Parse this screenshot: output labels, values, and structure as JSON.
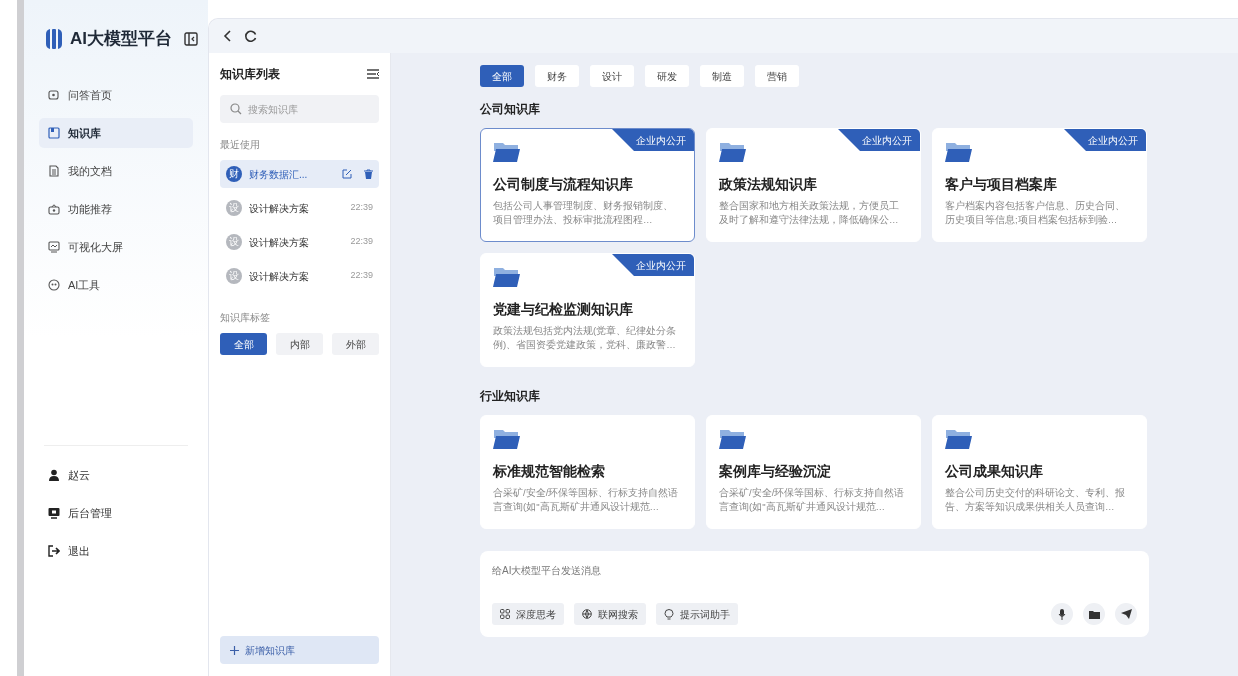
{
  "brand": "AI大模型平台",
  "sidebar": {
    "nav": [
      {
        "label": "问答首页",
        "selected": false
      },
      {
        "label": "知识库",
        "selected": true
      },
      {
        "label": "我的文档",
        "selected": false
      },
      {
        "label": "功能推荐",
        "selected": false
      },
      {
        "label": "可视化大屏",
        "selected": false
      },
      {
        "label": "AI工具",
        "selected": false
      }
    ],
    "user_menu": [
      {
        "label": "赵云"
      },
      {
        "label": "后台管理"
      },
      {
        "label": "退出"
      }
    ]
  },
  "list_panel": {
    "title": "知识库列表",
    "search": {
      "placeholder": "搜索知识库"
    },
    "recent_label": "最近使用",
    "recent": [
      {
        "avatar": "财",
        "name": "财务数据汇...",
        "selected": true
      },
      {
        "avatar": "设",
        "name": "设计解决方案",
        "time": "22:39",
        "selected": false
      },
      {
        "avatar": "设",
        "name": "设计解决方案",
        "time": "22:39",
        "selected": false
      },
      {
        "avatar": "设",
        "name": "设计解决方案",
        "time": "22:39",
        "selected": false
      }
    ],
    "tags_label": "知识库标签",
    "tags": [
      {
        "label": "全部",
        "selected": true
      },
      {
        "label": "内部",
        "selected": false
      },
      {
        "label": "外部",
        "selected": false
      }
    ],
    "add_button": "新增知识库"
  },
  "filters": [
    {
      "label": "全部",
      "selected": true
    },
    {
      "label": "财务",
      "selected": false
    },
    {
      "label": "设计",
      "selected": false
    },
    {
      "label": "研发",
      "selected": false
    },
    {
      "label": "制造",
      "selected": false
    },
    {
      "label": "营销",
      "selected": false
    }
  ],
  "sections": [
    {
      "title": "公司知识库",
      "cards": [
        {
          "title": "公司制度与流程知识库",
          "description": "包括公司人事管理制度、财务报销制度、项目管理办法、投标审批流程图程…",
          "badge": "企业内公开",
          "selected": true
        },
        {
          "title": "政策法规知识库",
          "description": "整合国家和地方相关政策法规，方便员工及时了解和遵守法律法规，降低确保公…",
          "badge": "企业内公开",
          "selected": false
        },
        {
          "title": "客户与项目档案库",
          "description": "客户档案内容包括客户信息、历史合同、历史项目等信息;项目档案包括标到验…",
          "badge": "企业内公开",
          "selected": false
        },
        {
          "title": "党建与纪检监测知识库",
          "description": "政策法规包括党内法规(党章、纪律处分条例)、省国资委党建政策，党科、廉政警…",
          "badge": "企业内公开",
          "selected": false
        }
      ]
    },
    {
      "title": "行业知识库",
      "cards": [
        {
          "title": "标准规范智能检索",
          "description": "合采矿/安全/环保等国标、行标支持自然语言查询(如\"高瓦斯矿井通风设计规范…",
          "selected": false
        },
        {
          "title": "案例库与经验沉淀",
          "description": "合采矿/安全/环保等国标、行标支持自然语言查询(如\"高瓦斯矿井通风设计规范…",
          "selected": false
        },
        {
          "title": "公司成果知识库",
          "description": "整合公司历史交付的科研论文、专利、报告、方案等知识成果供相关人员查询…",
          "selected": false
        }
      ]
    }
  ],
  "composer": {
    "placeholder": "给AI大模型平台发送消息",
    "tools": [
      {
        "label": "深度思考"
      },
      {
        "label": "联网搜索"
      },
      {
        "label": "提示词助手"
      }
    ]
  }
}
